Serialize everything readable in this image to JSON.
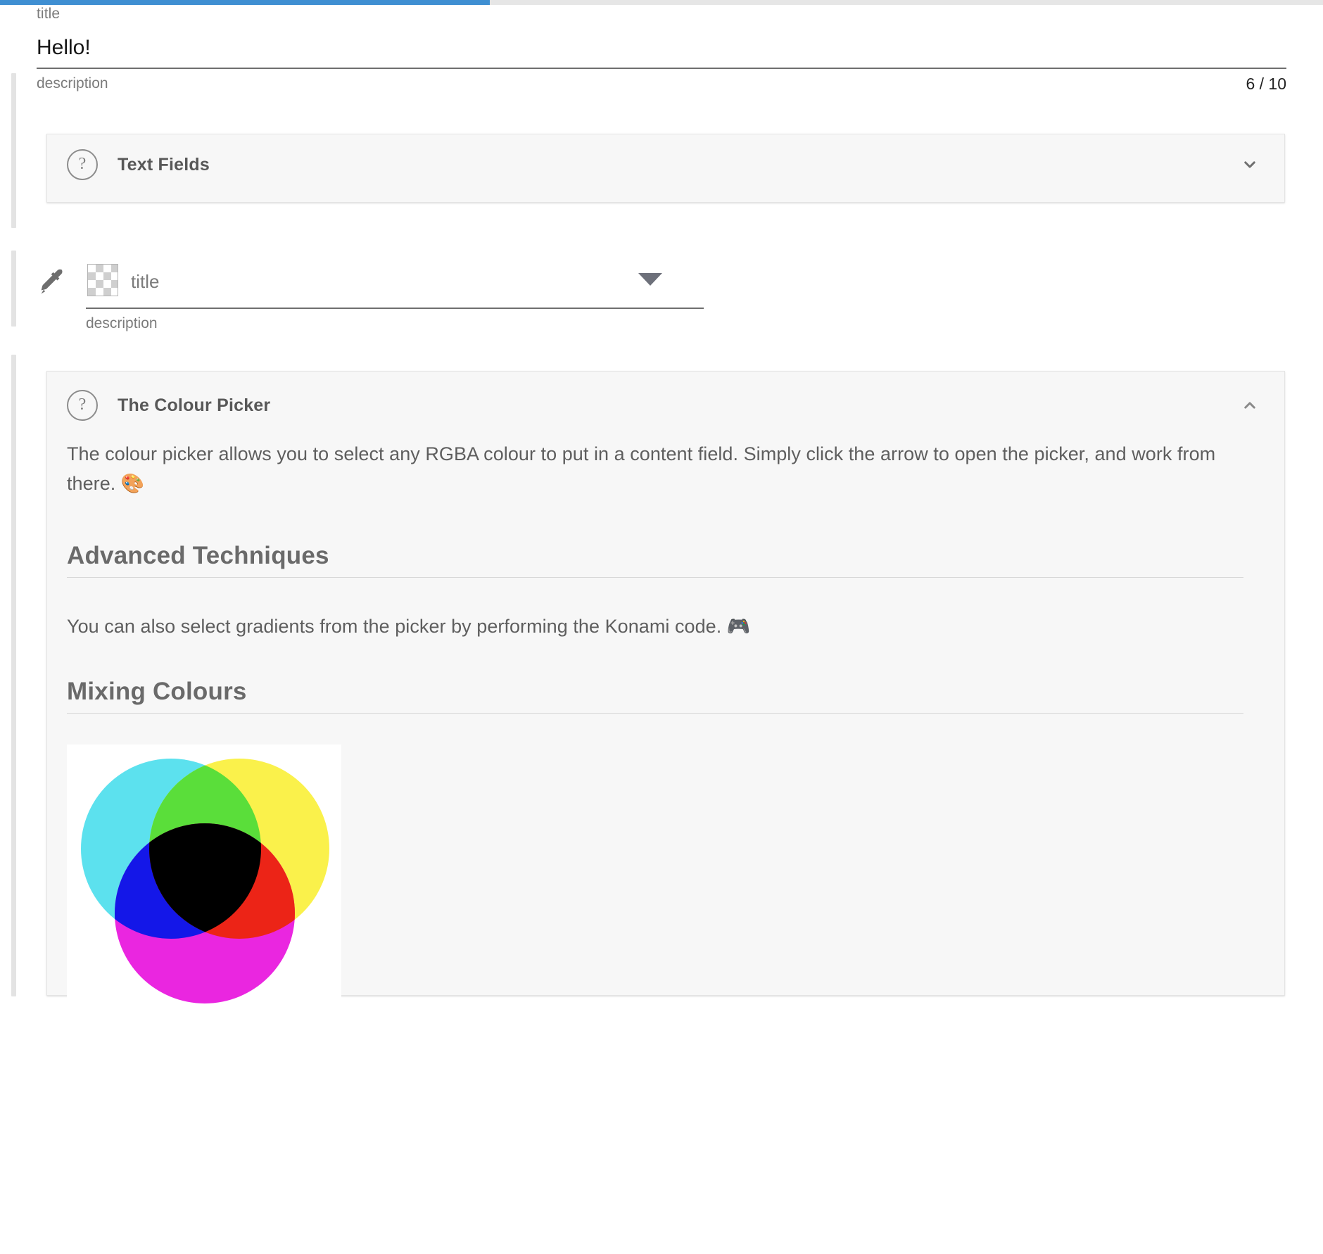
{
  "top_bar": {
    "accent_color": "#3f8fd2",
    "track_color": "#e6e6e6",
    "progress_pct": 37
  },
  "title_field": {
    "label": "title",
    "value": "Hello!",
    "hint": "description",
    "counter": "6 / 10",
    "max_length": 10,
    "current_length": 6
  },
  "text_fields_panel": {
    "help_icon": "question-mark-circle-icon",
    "title": "Text Fields",
    "toggle_icon": "chevron-down-icon",
    "expanded": false
  },
  "colour_field": {
    "eyedropper_icon": "eyedropper-icon",
    "swatch": "transparent-checkerboard",
    "placeholder": "title",
    "value": "",
    "dropdown_icon": "triangle-down-icon",
    "hint": "description"
  },
  "colour_picker_panel": {
    "help_icon": "question-mark-circle-icon",
    "title": "The Colour Picker",
    "toggle_icon": "chevron-up-icon",
    "expanded": true,
    "intro": "The colour picker allows you to select any RGBA colour to put in a content field. Simply click the arrow to open the picker, and work from there. 🎨",
    "sections": [
      {
        "heading": "Advanced Techniques",
        "body": "You can also select gradients from the picker by performing the Konami code. 🎮"
      },
      {
        "heading": "Mixing Colours",
        "body": ""
      }
    ],
    "venn_image": {
      "alt": "subtractive colour mixing venn diagram",
      "background": "#ffffff",
      "circles": [
        {
          "name": "cyan",
          "color": "#5CE1EE"
        },
        {
          "name": "yellow",
          "color": "#FAF14B"
        },
        {
          "name": "magenta",
          "color": "#EA26E0"
        }
      ],
      "overlaps": [
        {
          "name": "cyan+yellow",
          "color": "#5ADE3A"
        },
        {
          "name": "cyan+magenta",
          "color": "#1417E8"
        },
        {
          "name": "yellow+magenta",
          "color": "#EC2417"
        },
        {
          "name": "cyan+yellow+magenta",
          "color": "#000000"
        }
      ]
    }
  }
}
